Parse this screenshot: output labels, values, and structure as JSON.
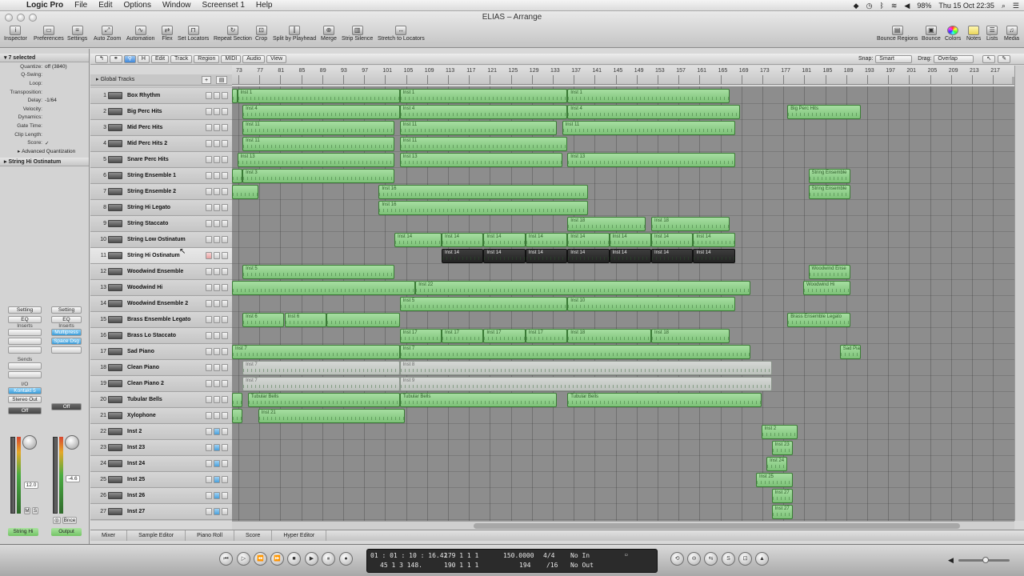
{
  "menubar": {
    "app_name": "Logic Pro",
    "menus": [
      "File",
      "Edit",
      "Options",
      "Window",
      "Screenset 1",
      "Help"
    ],
    "battery": "98%",
    "datetime": "Thu 15 Oct  22:35"
  },
  "window": {
    "title": "ELIAS – Arrange"
  },
  "toolbar": {
    "left": [
      "Inspector",
      "Preferences",
      "Settings",
      "Auto Zoom",
      "Automation",
      "Flex",
      "Set Locators",
      "Repeat Section",
      "Crop",
      "Split by Playhead",
      "Merge",
      "Strip Silence",
      "Stretch to Locators"
    ],
    "right": [
      "Bounce Regions",
      "Bounce",
      "Colors",
      "Notes",
      "Lists",
      "Media"
    ]
  },
  "inspector": {
    "header": "7 selected",
    "params": [
      {
        "k": "Quantize:",
        "v": "off (3840)"
      },
      {
        "k": "Q-Swing:",
        "v": ""
      },
      {
        "k": "Loop:",
        "v": ""
      },
      {
        "k": "Transposition:",
        "v": ""
      },
      {
        "k": "Delay:",
        "v": "-1/64"
      },
      {
        "k": "Velocity:",
        "v": ""
      },
      {
        "k": "Dynamics:",
        "v": ""
      },
      {
        "k": "Gate Time:",
        "v": ""
      },
      {
        "k": "Clip Length:",
        "v": ""
      },
      {
        "k": "Score:",
        "v": "✓"
      }
    ],
    "advanced": "Advanced Quantization",
    "track_header": "String Hi Ostinatum",
    "strip1": {
      "setting": "Setting",
      "eq": "EQ",
      "inserts": "Inserts",
      "sends": "Sends",
      "io": "I/O",
      "input": "Kontakt 5",
      "output": "Stereo Out",
      "auto": "Off",
      "value": "12.0",
      "name": "String Hi"
    },
    "strip2": {
      "setting": "Setting",
      "eq": "EQ",
      "inserts": "Inserts",
      "plugin1": "Multipress",
      "plugin2": "Space Dsg",
      "auto": "Off",
      "value": "-4.6",
      "bnce": "Bnce",
      "name": "Output"
    }
  },
  "arrange_toolbar": {
    "menus": [
      "Edit",
      "Track",
      "Region",
      "MIDI",
      "Audio",
      "View"
    ],
    "snap_label": "Snap:",
    "snap_value": "Smart",
    "drag_label": "Drag:",
    "drag_value": "Overlap"
  },
  "global_tracks": "Global Tracks",
  "ruler": [
    "73",
    "77",
    "81",
    "85",
    "89",
    "93",
    "97",
    "101",
    "105",
    "109",
    "113",
    "117",
    "121",
    "125",
    "129",
    "133",
    "137",
    "141",
    "145",
    "149",
    "153",
    "157",
    "161",
    "165",
    "169",
    "173",
    "177",
    "181",
    "185",
    "189",
    "193",
    "197",
    "201",
    "205",
    "209",
    "213",
    "217"
  ],
  "tracks": [
    {
      "n": "1",
      "name": "Box Rhythm"
    },
    {
      "n": "2",
      "name": "Big Perc Hits"
    },
    {
      "n": "3",
      "name": "Mid Perc Hits"
    },
    {
      "n": "4",
      "name": "Mid Perc Hits 2"
    },
    {
      "n": "5",
      "name": "Snare Perc Hits"
    },
    {
      "n": "6",
      "name": "String Ensemble 1"
    },
    {
      "n": "7",
      "name": "String Ensemble 2"
    },
    {
      "n": "8",
      "name": "String Hi Legato"
    },
    {
      "n": "9",
      "name": "String Staccato"
    },
    {
      "n": "10",
      "name": "String Low Ostinatum"
    },
    {
      "n": "11",
      "name": "String Hi Ostinatum"
    },
    {
      "n": "12",
      "name": "Woodwind Ensemble"
    },
    {
      "n": "13",
      "name": "Woodwind Hi"
    },
    {
      "n": "14",
      "name": "Woodwind Ensemble 2"
    },
    {
      "n": "15",
      "name": "Brass Ensemble Legato"
    },
    {
      "n": "16",
      "name": "Brass Lo Staccato"
    },
    {
      "n": "17",
      "name": "Sad Piano"
    },
    {
      "n": "18",
      "name": "Clean Piano"
    },
    {
      "n": "19",
      "name": "Clean Piano 2"
    },
    {
      "n": "20",
      "name": "Tubular Bells"
    },
    {
      "n": "21",
      "name": "Xylophone"
    },
    {
      "n": "22",
      "name": "Inst 2"
    },
    {
      "n": "23",
      "name": "Inst 23"
    },
    {
      "n": "24",
      "name": "Inst 24"
    },
    {
      "n": "25",
      "name": "Inst 25"
    },
    {
      "n": "26",
      "name": "Inst 26"
    },
    {
      "n": "27",
      "name": "Inst 27"
    }
  ],
  "regions": [
    {
      "t": 0,
      "s": 73,
      "e": 74,
      "l": ""
    },
    {
      "t": 0,
      "s": 74,
      "e": 105,
      "l": "Inst 1"
    },
    {
      "t": 0,
      "s": 105,
      "e": 137,
      "l": "Inst 1"
    },
    {
      "t": 0,
      "s": 137,
      "e": 168,
      "l": "Inst 1"
    },
    {
      "t": 1,
      "s": 75,
      "e": 105,
      "l": "Inst 4"
    },
    {
      "t": 1,
      "s": 105,
      "e": 137,
      "l": "Inst 4"
    },
    {
      "t": 1,
      "s": 137,
      "e": 170,
      "l": "Inst 4"
    },
    {
      "t": 1,
      "s": 179,
      "e": 193,
      "l": "Big Perc Hits"
    },
    {
      "t": 2,
      "s": 75,
      "e": 104,
      "l": "Inst 11"
    },
    {
      "t": 2,
      "s": 105,
      "e": 135,
      "l": "Inst 11"
    },
    {
      "t": 2,
      "s": 136,
      "e": 169,
      "l": "Inst 11"
    },
    {
      "t": 3,
      "s": 75,
      "e": 104,
      "l": "Inst 11"
    },
    {
      "t": 3,
      "s": 105,
      "e": 137,
      "l": "Inst 11"
    },
    {
      "t": 4,
      "s": 74,
      "e": 104,
      "l": "Inst 13"
    },
    {
      "t": 4,
      "s": 105,
      "e": 136,
      "l": "Inst 13"
    },
    {
      "t": 4,
      "s": 137,
      "e": 169,
      "l": "Inst 13"
    },
    {
      "t": 5,
      "s": 73,
      "e": 75,
      "l": ""
    },
    {
      "t": 5,
      "s": 75,
      "e": 104,
      "l": "Inst 3"
    },
    {
      "t": 5,
      "s": 183,
      "e": 191,
      "l": "String Ensemble"
    },
    {
      "t": 6,
      "s": 73,
      "e": 78,
      "l": ""
    },
    {
      "t": 6,
      "s": 101,
      "e": 141,
      "l": "Inst 16"
    },
    {
      "t": 6,
      "s": 183,
      "e": 191,
      "l": "String Ensemble"
    },
    {
      "t": 7,
      "s": 101,
      "e": 141,
      "l": "Inst 16"
    },
    {
      "t": 8,
      "s": 137,
      "e": 152,
      "l": "Inst 18"
    },
    {
      "t": 8,
      "s": 153,
      "e": 168,
      "l": "Inst 18"
    },
    {
      "t": 9,
      "s": 104,
      "e": 113,
      "l": "Inst 14"
    },
    {
      "t": 9,
      "s": 113,
      "e": 121,
      "l": "Inst 14"
    },
    {
      "t": 9,
      "s": 121,
      "e": 129,
      "l": "Inst 14"
    },
    {
      "t": 9,
      "s": 129,
      "e": 137,
      "l": "Inst 14"
    },
    {
      "t": 9,
      "s": 137,
      "e": 145,
      "l": "Inst 14"
    },
    {
      "t": 9,
      "s": 145,
      "e": 153,
      "l": "Inst 14"
    },
    {
      "t": 9,
      "s": 153,
      "e": 161,
      "l": "Inst 14"
    },
    {
      "t": 9,
      "s": 161,
      "e": 169,
      "l": "Inst 14"
    },
    {
      "t": 10,
      "s": 113,
      "e": 121,
      "l": "Inst 14",
      "k": "dark"
    },
    {
      "t": 10,
      "s": 121,
      "e": 129,
      "l": "Inst 14",
      "k": "dark"
    },
    {
      "t": 10,
      "s": 129,
      "e": 137,
      "l": "Inst 14",
      "k": "dark"
    },
    {
      "t": 10,
      "s": 137,
      "e": 145,
      "l": "Inst 14",
      "k": "dark"
    },
    {
      "t": 10,
      "s": 145,
      "e": 153,
      "l": "Inst 14",
      "k": "dark"
    },
    {
      "t": 10,
      "s": 153,
      "e": 161,
      "l": "Inst 14",
      "k": "dark"
    },
    {
      "t": 10,
      "s": 161,
      "e": 169,
      "l": "Inst 14",
      "k": "dark"
    },
    {
      "t": 11,
      "s": 75,
      "e": 104,
      "l": "Inst 5"
    },
    {
      "t": 11,
      "s": 183,
      "e": 191,
      "l": "Woodwind Ense"
    },
    {
      "t": 12,
      "s": 73,
      "e": 108,
      "l": ""
    },
    {
      "t": 12,
      "s": 108,
      "e": 172,
      "l": "Inst 22"
    },
    {
      "t": 12,
      "s": 182,
      "e": 191,
      "l": "Woodwind Hi"
    },
    {
      "t": 13,
      "s": 105,
      "e": 137,
      "l": "Inst 5"
    },
    {
      "t": 13,
      "s": 137,
      "e": 169,
      "l": "Inst 10"
    },
    {
      "t": 14,
      "s": 75,
      "e": 83,
      "l": "Inst 6"
    },
    {
      "t": 14,
      "s": 83,
      "e": 91,
      "l": "Inst 6"
    },
    {
      "t": 14,
      "s": 91,
      "e": 105,
      "l": ""
    },
    {
      "t": 14,
      "s": 179,
      "e": 191,
      "l": "Brass Ensemble Legato"
    },
    {
      "t": 15,
      "s": 105,
      "e": 113,
      "l": "Inst 17"
    },
    {
      "t": 15,
      "s": 113,
      "e": 121,
      "l": "Inst 17"
    },
    {
      "t": 15,
      "s": 121,
      "e": 129,
      "l": "Inst 17"
    },
    {
      "t": 15,
      "s": 129,
      "e": 137,
      "l": "Inst 17"
    },
    {
      "t": 15,
      "s": 137,
      "e": 153,
      "l": "Inst 18"
    },
    {
      "t": 15,
      "s": 153,
      "e": 168,
      "l": "Inst 18"
    },
    {
      "t": 16,
      "s": 73,
      "e": 105,
      "l": "Inst 7"
    },
    {
      "t": 16,
      "s": 105,
      "e": 172,
      "l": "Inst 7"
    },
    {
      "t": 16,
      "s": 189,
      "e": 193,
      "l": "Sad Pia"
    },
    {
      "t": 17,
      "s": 75,
      "e": 105,
      "l": "Inst 7",
      "k": "gray"
    },
    {
      "t": 17,
      "s": 105,
      "e": 176,
      "l": "Inst 8",
      "k": "gray"
    },
    {
      "t": 18,
      "s": 75,
      "e": 105,
      "l": "Inst 7",
      "k": "gray"
    },
    {
      "t": 18,
      "s": 105,
      "e": 176,
      "l": "Inst 9",
      "k": "gray"
    },
    {
      "t": 19,
      "s": 73,
      "e": 75,
      "l": ""
    },
    {
      "t": 19,
      "s": 76,
      "e": 105,
      "l": "Tubular Bells"
    },
    {
      "t": 19,
      "s": 105,
      "e": 135,
      "l": "Tubular Bells"
    },
    {
      "t": 19,
      "s": 137,
      "e": 174,
      "l": "Tubular Bells"
    },
    {
      "t": 20,
      "s": 73,
      "e": 75,
      "l": ""
    },
    {
      "t": 20,
      "s": 78,
      "e": 106,
      "l": "Inst 21"
    },
    {
      "t": 21,
      "s": 174,
      "e": 181,
      "l": "Inst 2"
    },
    {
      "t": 22,
      "s": 176,
      "e": 180,
      "l": "Inst 23"
    },
    {
      "t": 23,
      "s": 175,
      "e": 179,
      "l": "Inst 24"
    },
    {
      "t": 24,
      "s": 173,
      "e": 180,
      "l": "Inst 25"
    },
    {
      "t": 25,
      "s": 176,
      "e": 180,
      "l": "Inst 27"
    },
    {
      "t": 26,
      "s": 176,
      "e": 180,
      "l": "Inst 27"
    }
  ],
  "bottom_tabs": [
    "Mixer",
    "Sample Editor",
    "Piano Roll",
    "Score",
    "Hyper Editor"
  ],
  "lcd": {
    "smpte": "01 : 01 : 10 : 16.42",
    "bars": "45    1    3  148.",
    "pos1": "179    1    1    1",
    "pos2": "190    1    1    1",
    "tempo": "150.0000",
    "tempo2": "194",
    "sig": "4/4",
    "div": "/16",
    "in": "No In",
    "out": "No Out"
  }
}
